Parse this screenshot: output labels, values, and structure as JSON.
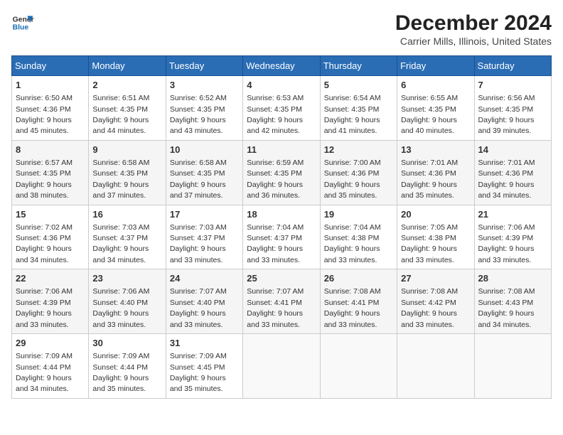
{
  "header": {
    "logo_line1": "General",
    "logo_line2": "Blue",
    "title": "December 2024",
    "subtitle": "Carrier Mills, Illinois, United States"
  },
  "weekdays": [
    "Sunday",
    "Monday",
    "Tuesday",
    "Wednesday",
    "Thursday",
    "Friday",
    "Saturday"
  ],
  "weeks": [
    [
      {
        "day": "1",
        "info": "Sunrise: 6:50 AM\nSunset: 4:36 PM\nDaylight: 9 hours\nand 45 minutes."
      },
      {
        "day": "2",
        "info": "Sunrise: 6:51 AM\nSunset: 4:35 PM\nDaylight: 9 hours\nand 44 minutes."
      },
      {
        "day": "3",
        "info": "Sunrise: 6:52 AM\nSunset: 4:35 PM\nDaylight: 9 hours\nand 43 minutes."
      },
      {
        "day": "4",
        "info": "Sunrise: 6:53 AM\nSunset: 4:35 PM\nDaylight: 9 hours\nand 42 minutes."
      },
      {
        "day": "5",
        "info": "Sunrise: 6:54 AM\nSunset: 4:35 PM\nDaylight: 9 hours\nand 41 minutes."
      },
      {
        "day": "6",
        "info": "Sunrise: 6:55 AM\nSunset: 4:35 PM\nDaylight: 9 hours\nand 40 minutes."
      },
      {
        "day": "7",
        "info": "Sunrise: 6:56 AM\nSunset: 4:35 PM\nDaylight: 9 hours\nand 39 minutes."
      }
    ],
    [
      {
        "day": "8",
        "info": "Sunrise: 6:57 AM\nSunset: 4:35 PM\nDaylight: 9 hours\nand 38 minutes."
      },
      {
        "day": "9",
        "info": "Sunrise: 6:58 AM\nSunset: 4:35 PM\nDaylight: 9 hours\nand 37 minutes."
      },
      {
        "day": "10",
        "info": "Sunrise: 6:58 AM\nSunset: 4:35 PM\nDaylight: 9 hours\nand 37 minutes."
      },
      {
        "day": "11",
        "info": "Sunrise: 6:59 AM\nSunset: 4:35 PM\nDaylight: 9 hours\nand 36 minutes."
      },
      {
        "day": "12",
        "info": "Sunrise: 7:00 AM\nSunset: 4:36 PM\nDaylight: 9 hours\nand 35 minutes."
      },
      {
        "day": "13",
        "info": "Sunrise: 7:01 AM\nSunset: 4:36 PM\nDaylight: 9 hours\nand 35 minutes."
      },
      {
        "day": "14",
        "info": "Sunrise: 7:01 AM\nSunset: 4:36 PM\nDaylight: 9 hours\nand 34 minutes."
      }
    ],
    [
      {
        "day": "15",
        "info": "Sunrise: 7:02 AM\nSunset: 4:36 PM\nDaylight: 9 hours\nand 34 minutes."
      },
      {
        "day": "16",
        "info": "Sunrise: 7:03 AM\nSunset: 4:37 PM\nDaylight: 9 hours\nand 34 minutes."
      },
      {
        "day": "17",
        "info": "Sunrise: 7:03 AM\nSunset: 4:37 PM\nDaylight: 9 hours\nand 33 minutes."
      },
      {
        "day": "18",
        "info": "Sunrise: 7:04 AM\nSunset: 4:37 PM\nDaylight: 9 hours\nand 33 minutes."
      },
      {
        "day": "19",
        "info": "Sunrise: 7:04 AM\nSunset: 4:38 PM\nDaylight: 9 hours\nand 33 minutes."
      },
      {
        "day": "20",
        "info": "Sunrise: 7:05 AM\nSunset: 4:38 PM\nDaylight: 9 hours\nand 33 minutes."
      },
      {
        "day": "21",
        "info": "Sunrise: 7:06 AM\nSunset: 4:39 PM\nDaylight: 9 hours\nand 33 minutes."
      }
    ],
    [
      {
        "day": "22",
        "info": "Sunrise: 7:06 AM\nSunset: 4:39 PM\nDaylight: 9 hours\nand 33 minutes."
      },
      {
        "day": "23",
        "info": "Sunrise: 7:06 AM\nSunset: 4:40 PM\nDaylight: 9 hours\nand 33 minutes."
      },
      {
        "day": "24",
        "info": "Sunrise: 7:07 AM\nSunset: 4:40 PM\nDaylight: 9 hours\nand 33 minutes."
      },
      {
        "day": "25",
        "info": "Sunrise: 7:07 AM\nSunset: 4:41 PM\nDaylight: 9 hours\nand 33 minutes."
      },
      {
        "day": "26",
        "info": "Sunrise: 7:08 AM\nSunset: 4:41 PM\nDaylight: 9 hours\nand 33 minutes."
      },
      {
        "day": "27",
        "info": "Sunrise: 7:08 AM\nSunset: 4:42 PM\nDaylight: 9 hours\nand 33 minutes."
      },
      {
        "day": "28",
        "info": "Sunrise: 7:08 AM\nSunset: 4:43 PM\nDaylight: 9 hours\nand 34 minutes."
      }
    ],
    [
      {
        "day": "29",
        "info": "Sunrise: 7:09 AM\nSunset: 4:44 PM\nDaylight: 9 hours\nand 34 minutes."
      },
      {
        "day": "30",
        "info": "Sunrise: 7:09 AM\nSunset: 4:44 PM\nDaylight: 9 hours\nand 35 minutes."
      },
      {
        "day": "31",
        "info": "Sunrise: 7:09 AM\nSunset: 4:45 PM\nDaylight: 9 hours\nand 35 minutes."
      },
      null,
      null,
      null,
      null
    ]
  ]
}
